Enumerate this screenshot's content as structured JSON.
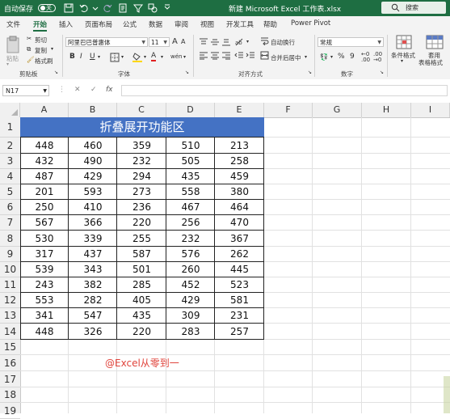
{
  "titlebar": {
    "autosave_label": "自动保存",
    "autosave_state": "关",
    "file_title": "新建 Microsoft Excel 工作表.xlsx",
    "search_placeholder": "搜索"
  },
  "menu": {
    "tabs": [
      "文件",
      "开始",
      "插入",
      "页面布局",
      "公式",
      "数据",
      "审阅",
      "视图",
      "开发工具",
      "帮助",
      "Power Pivot"
    ],
    "active": "开始"
  },
  "ribbon": {
    "clipboard": {
      "paste": "粘贴",
      "cut": "剪切",
      "copy": "复制",
      "format_painter": "格式刷",
      "group": "剪贴板"
    },
    "font": {
      "name": "阿里巴巴普惠体",
      "size": "11",
      "bold": "B",
      "italic": "I",
      "underline": "U",
      "group": "字体",
      "grow": "A",
      "shrink": "A",
      "font_color": "A",
      "phonetic": "wén"
    },
    "alignment": {
      "wrap": "自动换行",
      "merge": "合并后居中",
      "group": "对齐方式"
    },
    "number": {
      "format": "常规",
      "percent": "%",
      "comma": "9",
      "group": "数字"
    },
    "styles": {
      "conditional": "条件格式",
      "table_line1": "套用",
      "table_line2": "表格格式"
    }
  },
  "formula_bar": {
    "namebox": "N17",
    "fx": "fx",
    "cancel": "✕",
    "enter": "✓",
    "value": ""
  },
  "columns": [
    "A",
    "B",
    "C",
    "D",
    "E",
    "F",
    "G",
    "H",
    "I"
  ],
  "rows": [
    "1",
    "2",
    "3",
    "4",
    "5",
    "6",
    "7",
    "8",
    "9",
    "10",
    "11",
    "12",
    "13",
    "14",
    "15",
    "16",
    "17",
    "18",
    "19"
  ],
  "sheet": {
    "title": "折叠展开功能区",
    "data": [
      [
        "448",
        "460",
        "359",
        "510",
        "213"
      ],
      [
        "432",
        "490",
        "232",
        "505",
        "258"
      ],
      [
        "487",
        "429",
        "294",
        "435",
        "459"
      ],
      [
        "201",
        "593",
        "273",
        "558",
        "380"
      ],
      [
        "250",
        "410",
        "236",
        "467",
        "464"
      ],
      [
        "567",
        "366",
        "220",
        "256",
        "470"
      ],
      [
        "530",
        "339",
        "255",
        "232",
        "367"
      ],
      [
        "317",
        "437",
        "587",
        "576",
        "262"
      ],
      [
        "539",
        "343",
        "501",
        "260",
        "445"
      ],
      [
        "243",
        "382",
        "285",
        "452",
        "523"
      ],
      [
        "553",
        "282",
        "405",
        "429",
        "581"
      ],
      [
        "341",
        "547",
        "435",
        "309",
        "231"
      ],
      [
        "448",
        "326",
        "220",
        "283",
        "257"
      ]
    ]
  },
  "watermark": "@Excel从零到一",
  "colors": {
    "title_bar": "#1e6e42",
    "header_fill": "#4472c4",
    "watermark": "#e0433b"
  }
}
